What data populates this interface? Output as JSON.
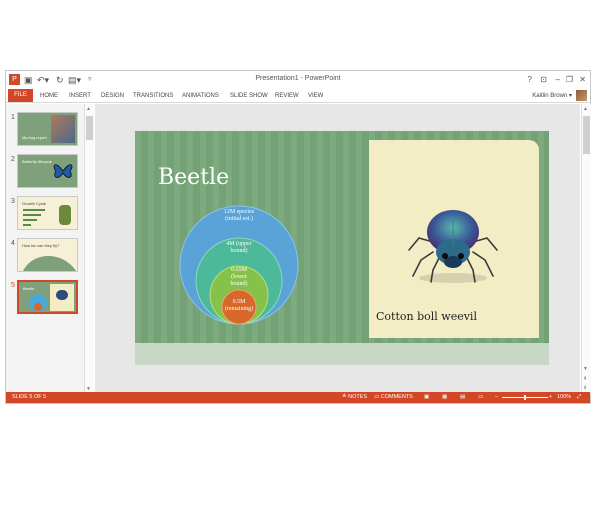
{
  "window": {
    "title": "Presentation1 - PowerPoint",
    "controls": {
      "help": "?",
      "restore_ribbon": "⊡",
      "minimize": "–",
      "maximize": "❐",
      "close": "✕"
    }
  },
  "quick_access": {
    "app_icon": "powerpoint-icon",
    "save": "save-icon",
    "undo": "undo-icon",
    "redo": "redo-icon",
    "start": "start-from-beginning-icon",
    "customize": "customize-icon"
  },
  "ribbon": {
    "file": "FILE",
    "tabs": [
      "HOME",
      "INSERT",
      "DESIGN",
      "TRANSITIONS",
      "ANIMATIONS",
      "SLIDE SHOW",
      "REVIEW",
      "VIEW"
    ],
    "user": "Kaitlin Brown",
    "user_dropdown": "▾"
  },
  "thumbnails": [
    {
      "num": "1",
      "text": "My bug report"
    },
    {
      "num": "2",
      "text": "Butterfly lifecycle"
    },
    {
      "num": "3",
      "text": "Growth Cycle"
    },
    {
      "num": "4",
      "text": "How far can they fly?"
    },
    {
      "num": "5",
      "text": "Beetle"
    }
  ],
  "slide": {
    "title": "Beetle",
    "caption": "Cotton boll weevil",
    "circles": [
      {
        "line1": "12M species",
        "line2": "(initial est.)",
        "line3": ""
      },
      {
        "line1": "4M (upper",
        "line2": "bound)",
        "line3": ""
      },
      {
        "line1": "0.65M",
        "line2": "(lower",
        "line3": "bound)"
      },
      {
        "line1": "0.5M",
        "line2": "(remaining)",
        "line3": ""
      }
    ]
  },
  "status": {
    "slide": "SLIDE 5 OF 5",
    "notes": "NOTES",
    "comments": "COMMENTS",
    "zoom": "100%",
    "zoom_minus": "–",
    "zoom_plus": "+"
  },
  "colors": {
    "accent": "#d24726",
    "slide_green": "#78a77a",
    "panel": "#f3edc5"
  }
}
